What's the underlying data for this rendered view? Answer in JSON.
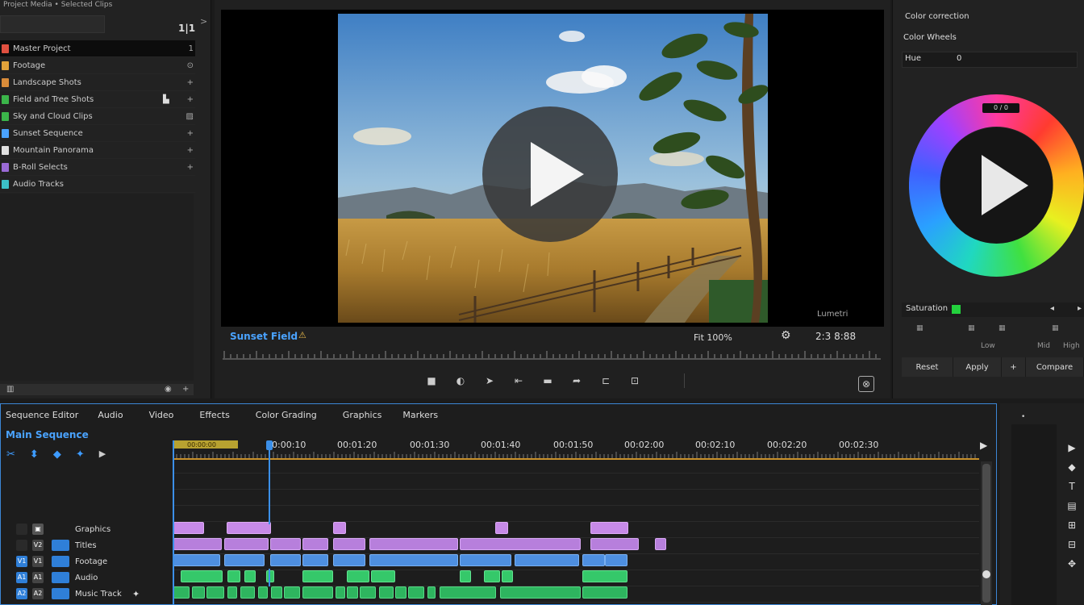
{
  "left_panel": {
    "title": "Project Media • Selected Clips",
    "badge": "1|1",
    "collapse": ">",
    "bins": [
      {
        "label": "Master Project",
        "mark": "1",
        "thumb": "#e05040",
        "selected": true,
        "extra": ""
      },
      {
        "label": "Footage",
        "mark": "⊙",
        "thumb": "#e2a23a",
        "selected": false,
        "extra": ""
      },
      {
        "label": "Landscape Shots",
        "mark": "+",
        "thumb": "#d98c3a",
        "selected": false,
        "extra": ""
      },
      {
        "label": "Field and Tree Shots",
        "mark": "+",
        "thumb": "#3bb54a",
        "selected": false,
        "extra": "▙"
      },
      {
        "label": "Sky and Cloud Clips",
        "mark": "▨",
        "thumb": "#3bb54a",
        "selected": false,
        "extra": ""
      },
      {
        "label": "Sunset Sequence",
        "mark": "+",
        "thumb": "#4aa3ff",
        "selected": false,
        "extra": ""
      },
      {
        "label": "Mountain Panorama",
        "mark": "+",
        "thumb": "#e0e0e0",
        "selected": false,
        "extra": ""
      },
      {
        "label": "B-Roll Selects",
        "mark": "+",
        "thumb": "#9a6ad6",
        "selected": false,
        "extra": ""
      },
      {
        "label": "Audio Tracks",
        "mark": "",
        "thumb": "#3cc0c8",
        "selected": false,
        "extra": ""
      }
    ],
    "footer": {
      "left": "▥",
      "mid": "◉",
      "right": "+"
    }
  },
  "viewer": {
    "clip_name": "Sunset Field",
    "clip_icon": "⚠",
    "fit_label": "Fit 100%",
    "wrench": "⚙",
    "timecode": "2:3 8:88",
    "corner_label": "Lumetri",
    "transport": [
      "■",
      "◐",
      "➤",
      "⇤",
      "▬",
      "➦",
      "⊏",
      "⊡"
    ],
    "export_icon": "⊗",
    "play_icon": "play-icon"
  },
  "inspector": {
    "title": "Color correction",
    "subtitle": "Color Wheels",
    "row_label": "Hue",
    "row_value": "0",
    "wheel_chip": "0 / 0",
    "effect_label": "Saturation",
    "effect_color": "#23d13d",
    "effect_arrow": "◂",
    "effect_arrow2": "▸",
    "params": [
      "▦",
      "▦",
      "▦",
      "▦",
      "Low",
      "Mid",
      "High"
    ],
    "buttons": [
      "Reset",
      "Apply",
      "+",
      "Compare"
    ]
  },
  "timeline": {
    "tabs": [
      "Sequence Editor",
      "Audio",
      "Video",
      "Effects",
      "Color Grading",
      "Graphics",
      "Markers"
    ],
    "sequence_name": "Main Sequence",
    "tools": [
      "✂",
      "⬍",
      "◆",
      "✦",
      "▶"
    ],
    "timecodes": [
      "00:00:00",
      "00:00:10",
      "00:01:20",
      "00:01:30",
      "00:01:40",
      "00:01:50",
      "00:02:00",
      "00:02:10",
      "00:02:20",
      "00:02:30"
    ],
    "ruler_play": "▶",
    "tracks": [
      {
        "name": "Graphics",
        "sq1": "",
        "sq2": "▣",
        "extra": ""
      },
      {
        "name": "Titles",
        "sq1": "",
        "sq2": "V2",
        "extra": ""
      },
      {
        "name": "Footage",
        "sq1": "V1",
        "sq2": "V1",
        "extra": ""
      },
      {
        "name": "Audio",
        "sq1": "A1",
        "sq2": "A1",
        "extra": ""
      },
      {
        "name": "Music Track",
        "sq1": "A2",
        "sq2": "A2",
        "extra": "✦"
      }
    ]
  },
  "mini_panel": {
    "dot": "•",
    "icons": [
      "▶",
      "◆",
      "T",
      "▤",
      "⊞",
      "⊟",
      "✥"
    ]
  }
}
